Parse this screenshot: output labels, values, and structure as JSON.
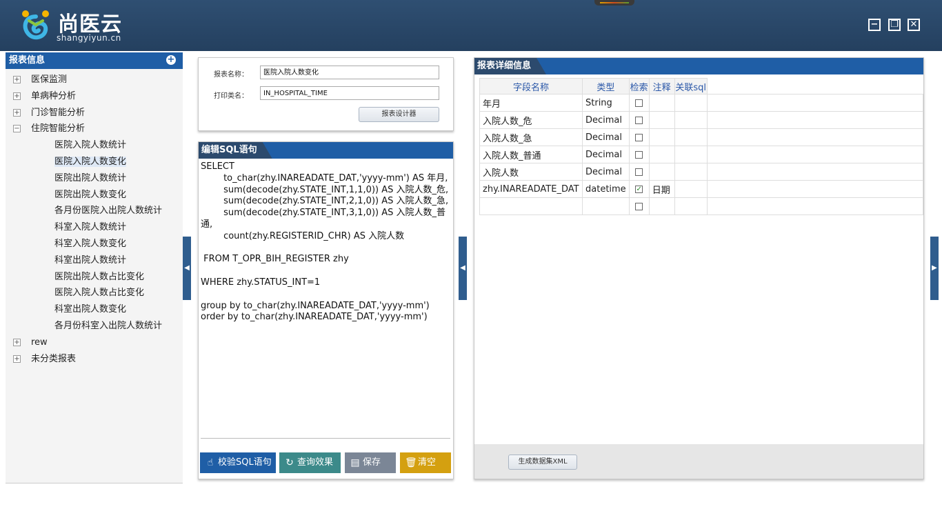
{
  "header": {
    "brand_name": "尚医云",
    "brand_domain": "shangyiyun.cn",
    "minimize_symbol": "−",
    "restore_symbol": "❐",
    "close_symbol": "✕"
  },
  "sidebar": {
    "title": "报表信息",
    "add_symbol": "+",
    "tree": [
      {
        "label": "医保监测",
        "level": 0,
        "toggle": "+"
      },
      {
        "label": "单病种分析",
        "level": 0,
        "toggle": "+"
      },
      {
        "label": "门诊智能分析",
        "level": 0,
        "toggle": "+"
      },
      {
        "label": "住院智能分析",
        "level": 0,
        "toggle": "−"
      },
      {
        "label": "医院入院人数统计",
        "level": 1
      },
      {
        "label": "医院入院人数变化",
        "level": 1,
        "selected": true
      },
      {
        "label": "医院出院人数统计",
        "level": 1
      },
      {
        "label": "医院出院人数变化",
        "level": 1
      },
      {
        "label": "各月份医院入出院人数统计",
        "level": 1
      },
      {
        "label": "科室入院人数统计",
        "level": 1
      },
      {
        "label": "科室入院人数变化",
        "level": 1
      },
      {
        "label": "科室出院人数统计",
        "level": 1
      },
      {
        "label": "医院出院人数占比变化",
        "level": 1
      },
      {
        "label": "医院入院人数占比变化",
        "level": 1
      },
      {
        "label": "科室出院人数变化",
        "level": 1
      },
      {
        "label": "各月份科室入出院人数统计",
        "level": 1
      },
      {
        "label": "rew",
        "level": 0,
        "toggle": "+"
      },
      {
        "label": "未分类报表",
        "level": 0,
        "toggle": "+"
      }
    ]
  },
  "report_info": {
    "name_label": "报表名称：",
    "name_value": "医院入院人数变化",
    "print_label": "打印类名：",
    "print_value": "IN_HOSPITAL_TIME",
    "designer_button": "报表设计器"
  },
  "sql_editor": {
    "title": "编辑SQL语句",
    "sql": "SELECT\n        to_char(zhy.INAREADATE_DAT,'yyyy-mm') AS 年月,\n        sum(decode(zhy.STATE_INT,1,1,0)) AS 入院人数_危,\n        sum(decode(zhy.STATE_INT,2,1,0)) AS 入院人数_急,\n        sum(decode(zhy.STATE_INT,3,1,0)) AS 入院人数_普通,\n        count(zhy.REGISTERID_CHR) AS 入院人数\n\n FROM T_OPR_BIH_REGISTER zhy\n\nWHERE zhy.STATUS_INT=1\n\ngroup by to_char(zhy.INAREADATE_DAT,'yyyy-mm')\norder by to_char(zhy.INAREADATE_DAT,'yyyy-mm')",
    "buttons": [
      {
        "label": "校验SQL语句",
        "icon": "hand-icon",
        "color": "#1f5ea6"
      },
      {
        "label": "查询效果",
        "icon": "refresh-icon",
        "color": "#3c8a8a"
      },
      {
        "label": "保存",
        "icon": "document-icon",
        "color": "#7b8696"
      },
      {
        "label": "清空",
        "icon": "trash-icon",
        "color": "#d4a010"
      }
    ]
  },
  "detail": {
    "title": "报表详细信息",
    "columns": [
      "字段名称",
      "类型",
      "检索",
      "注释",
      "关联sql"
    ],
    "rows": [
      {
        "field": "年月",
        "type": "String",
        "search": false,
        "note": "",
        "sql": ""
      },
      {
        "field": "入院人数_危",
        "type": "Decimal",
        "search": false,
        "note": "",
        "sql": ""
      },
      {
        "field": "入院人数_急",
        "type": "Decimal",
        "search": false,
        "note": "",
        "sql": ""
      },
      {
        "field": "入院人数_普通",
        "type": "Decimal",
        "search": false,
        "note": "",
        "sql": ""
      },
      {
        "field": "入院人数",
        "type": "Decimal",
        "search": false,
        "note": "",
        "sql": ""
      },
      {
        "field": "zhy.INAREADATE_DAT",
        "type": "datetime",
        "search": true,
        "note": "日期",
        "sql": ""
      },
      {
        "field": "",
        "type": "",
        "search": false,
        "note": "",
        "sql": ""
      }
    ],
    "generate_button": "生成数据集XML"
  },
  "collapse_arrows": {
    "left": "◀",
    "right": "▶"
  },
  "colors": {
    "header_bg": "#2a4868",
    "panel_blue": "#1f5ea6",
    "tab_dark": "#2c4a6d"
  }
}
